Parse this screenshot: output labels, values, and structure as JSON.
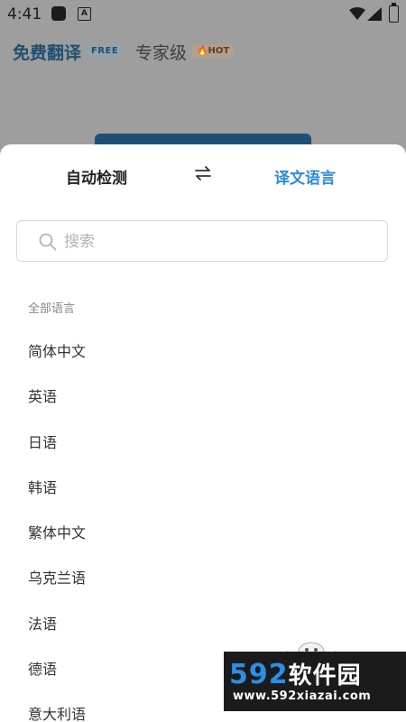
{
  "status_bar": {
    "time": "4:41",
    "a_icon": "A"
  },
  "background": {
    "free_title": "免费翻译",
    "free_badge": "FREE",
    "pro_title": "专家级",
    "hot_badge": "🔥HOT"
  },
  "sheet": {
    "source_language": "自动检测",
    "target_language": "译文语言",
    "search_placeholder": "搜索",
    "section_label": "全部语言",
    "languages": [
      "简体中文",
      "英语",
      "日语",
      "韩语",
      "繁体中文",
      "乌克兰语",
      "法语",
      "德语",
      "意大利语"
    ]
  },
  "watermark": {
    "main_digits": "592",
    "main_cn": "软件园",
    "url": "www.592xiazai.com"
  },
  "colors": {
    "accent": "#2f8bd6",
    "header_blue": "#1e4f72",
    "watermark_bg": "#1b1b1b"
  },
  "icons": [
    "swap-arrows-icon",
    "search-icon",
    "wifi-icon",
    "signal-icon",
    "battery-icon"
  ]
}
